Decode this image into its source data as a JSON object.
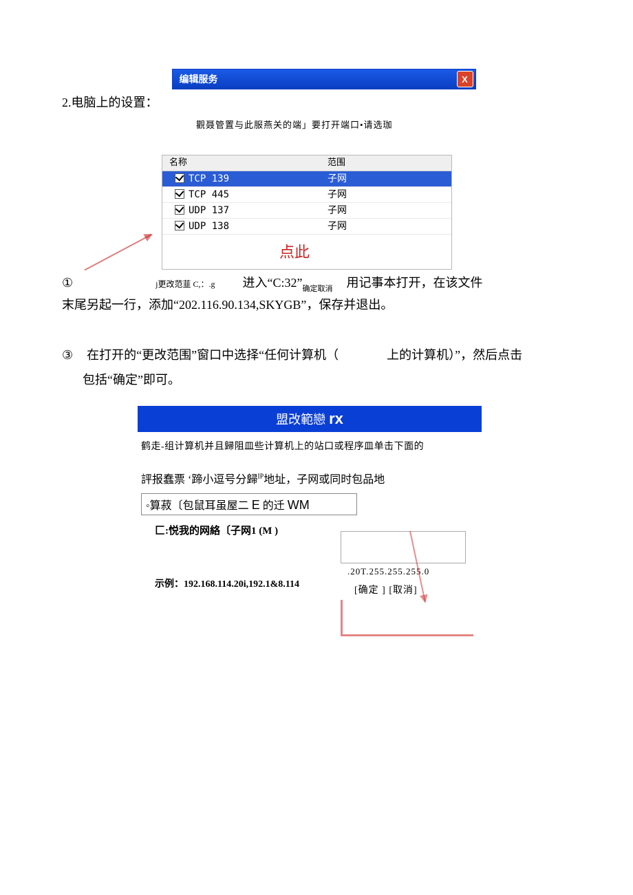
{
  "section_label": "2.电脑上的设置：",
  "dialog1": {
    "title": "编辑服务",
    "close": "X",
    "subtitle": "觀聂管置与此服燕关的端」要打开端口•请选珈",
    "headers": {
      "name": "名称",
      "scope": "范围"
    },
    "rows": [
      {
        "name": "TCP 139",
        "scope": "子网",
        "selected": true
      },
      {
        "name": "TCP 445",
        "scope": "子网",
        "selected": false
      },
      {
        "name": "UDP 137",
        "scope": "子网",
        "selected": false
      },
      {
        "name": "UDP 138",
        "scope": "子网",
        "selected": false
      }
    ],
    "click_hint": "点此"
  },
  "step1": {
    "num": "①",
    "small": "j更改范韮 C,：.g",
    "mid_a": "进入“C:32”",
    "mid_sub": "确定取消",
    "right": "用记事本打开，在该文件"
  },
  "step1_line2": "末尾另起一行，添加“202.116.90.134,SKYGB”，保存并退出。",
  "step3": {
    "num": "③",
    "t1": "在打开的“更改范围”窗口中选择“任何计算机（",
    "t2": "上的计算机）”，然后点击",
    "t3": "包括“确定”即可。"
  },
  "dialog2": {
    "bar_a": "盟改範戀",
    "bar_b": "rx",
    "line1": "鹤走-组计算机并且歸阻皿些计算机上的站口或程序皿单击下面的",
    "line2_a": "評报蠢票 ‘蹄小逗号分歸",
    "line2_ip": "IP",
    "line2_b": "地址，子网或同时包品地",
    "opt1_a": "◦算菽〔包鼠耳虽屋二",
    "opt1_e": "E",
    "opt1_b": "的迁",
    "opt1_wm": "WM",
    "opt2": "匚:悦我的网絡〔子网1 (M )",
    "ip_sample": ".20T.255.255.255.0",
    "ok": "[确定 ]",
    "cancel": "[取消]",
    "example": "示例：192.168.114.20i,192.1&8.114"
  }
}
